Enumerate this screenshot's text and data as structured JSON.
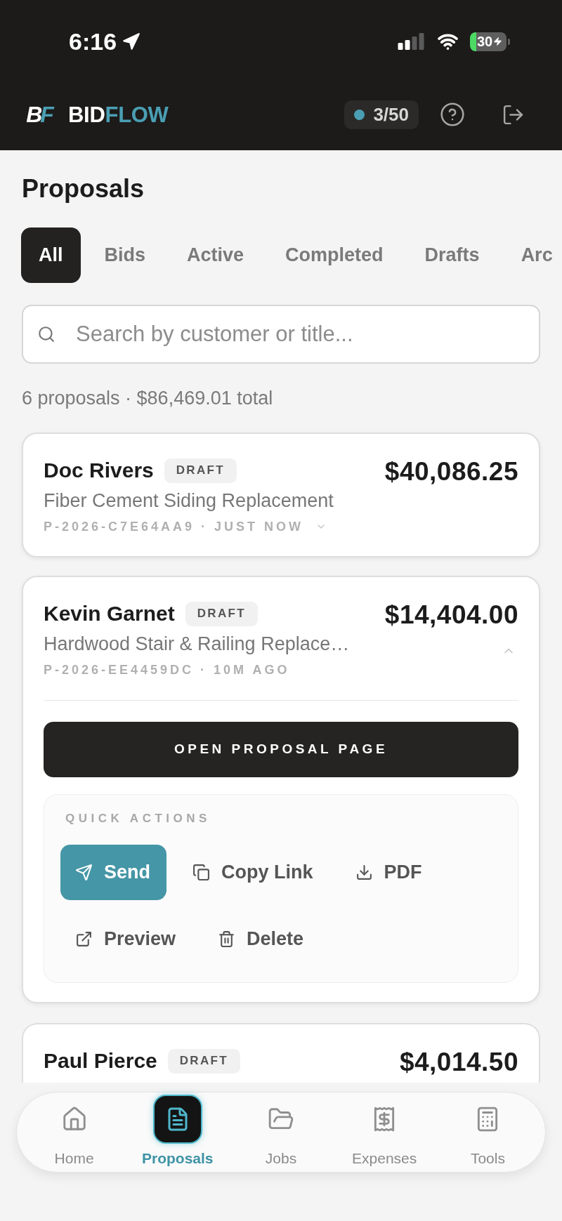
{
  "status_bar": {
    "time": "6:16",
    "battery": "30"
  },
  "header": {
    "logo_mark": [
      "B",
      "F"
    ],
    "brand": [
      "BID",
      "FLOW"
    ],
    "usage": "3/50"
  },
  "page": {
    "title": "Proposals"
  },
  "tabs": [
    {
      "label": "All",
      "selected": true
    },
    {
      "label": "Bids",
      "selected": false
    },
    {
      "label": "Active",
      "selected": false
    },
    {
      "label": "Completed",
      "selected": false
    },
    {
      "label": "Drafts",
      "selected": false
    },
    {
      "label": "Arc",
      "selected": false
    }
  ],
  "search": {
    "placeholder": "Search by customer or title..."
  },
  "summary": "6 proposals · $86,469.01 total",
  "proposals": [
    {
      "customer": "Doc Rivers",
      "status": "DRAFT",
      "amount": "$40,086.25",
      "title": "Fiber Cement Siding Replacement",
      "meta": "P-2026-C7E64AA9 · JUST NOW",
      "expanded": false
    },
    {
      "customer": "Kevin Garnet",
      "status": "DRAFT",
      "amount": "$14,404.00",
      "title": "Hardwood Stair & Railing Replace…",
      "meta": "P-2026-EE4459DC · 10M AGO",
      "expanded": true,
      "open_button": "OPEN PROPOSAL PAGE",
      "quick_actions": {
        "heading": "QUICK ACTIONS",
        "actions": [
          {
            "kind": "send",
            "label": "Send",
            "primary": true
          },
          {
            "kind": "copy",
            "label": "Copy Link",
            "primary": false
          },
          {
            "kind": "download",
            "label": "PDF",
            "primary": false
          },
          {
            "kind": "preview",
            "label": "Preview",
            "primary": false
          },
          {
            "kind": "delete",
            "label": "Delete",
            "primary": false
          }
        ]
      }
    },
    {
      "customer": "Paul Pierce",
      "status": "DRAFT",
      "amount": "$4,014.50"
    }
  ],
  "bottom_nav": [
    {
      "kind": "home",
      "label": "Home",
      "selected": false
    },
    {
      "kind": "proposals",
      "label": "Proposals",
      "selected": true
    },
    {
      "kind": "jobs",
      "label": "Jobs",
      "selected": false
    },
    {
      "kind": "expenses",
      "label": "Expenses",
      "selected": false
    },
    {
      "kind": "tools",
      "label": "Tools",
      "selected": false
    }
  ]
}
